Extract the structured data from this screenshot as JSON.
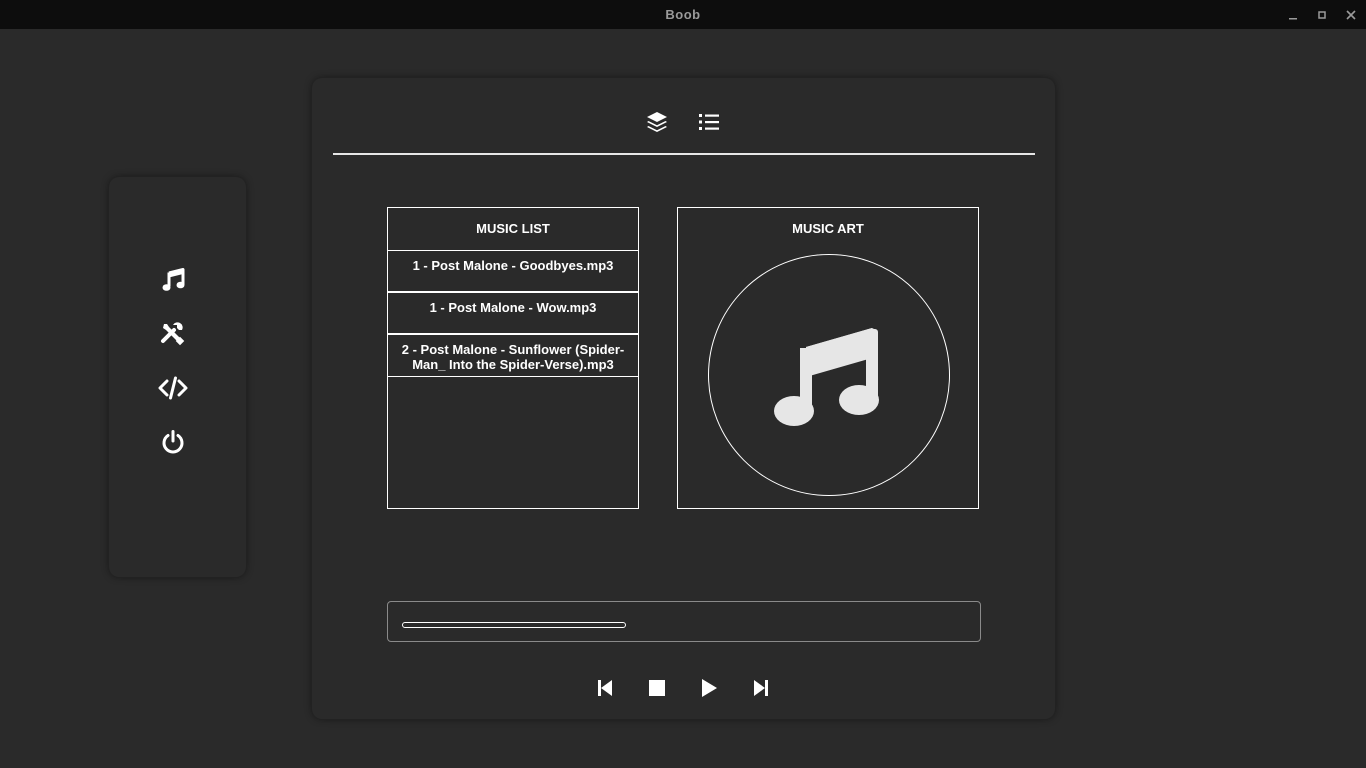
{
  "window": {
    "title": "Boob",
    "controls": [
      "minimize-icon",
      "maximize-icon",
      "close-icon"
    ]
  },
  "sidebar": {
    "items": [
      {
        "name": "music",
        "icon": "music-note-icon"
      },
      {
        "name": "tools",
        "icon": "tools-icon"
      },
      {
        "name": "code",
        "icon": "code-icon"
      },
      {
        "name": "power",
        "icon": "power-icon"
      }
    ]
  },
  "tabs": [
    {
      "name": "layers",
      "icon": "layers-icon"
    },
    {
      "name": "list",
      "icon": "list-icon"
    }
  ],
  "music_list": {
    "title": "MUSIC LIST",
    "tracks": [
      "1 - Post Malone - Goodbyes.mp3",
      "1 - Post Malone - Wow.mp3",
      "2 - Post Malone - Sunflower (Spider-Man_ Into the Spider-Verse).mp3"
    ]
  },
  "music_art": {
    "title": "MUSIC ART",
    "icon": "music-note-icon"
  },
  "player": {
    "progress": 0.0,
    "controls": [
      "previous-icon",
      "stop-icon",
      "play-icon",
      "next-icon"
    ]
  },
  "colors": {
    "background": "#2a2a2a",
    "titlebar": "#0d0d0d",
    "foreground": "#ffffff"
  }
}
